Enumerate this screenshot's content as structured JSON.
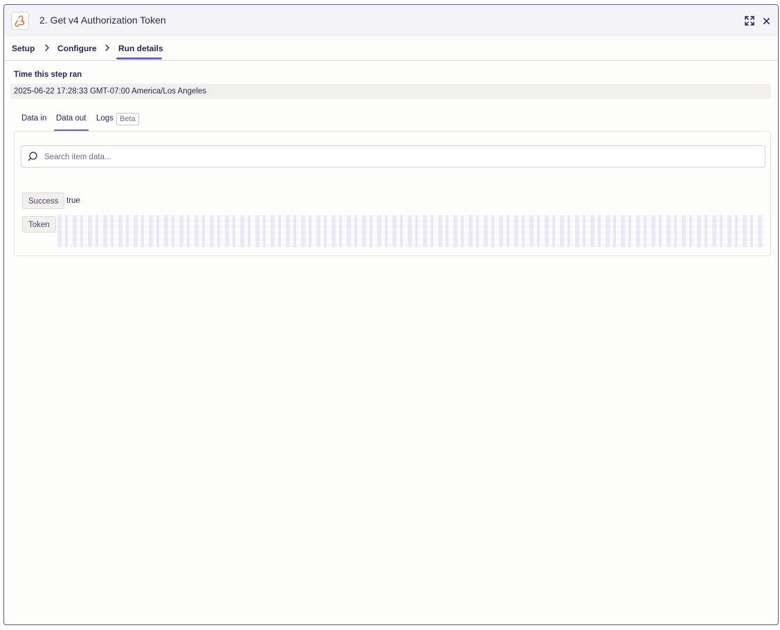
{
  "header": {
    "title": "2. Get v4 Authorization Token",
    "app_icon": "webhook-icon",
    "expand_icon": "expand-icon",
    "close_icon": "close-icon"
  },
  "breadcrumb": {
    "items": [
      {
        "label": "Setup"
      },
      {
        "label": "Configure"
      },
      {
        "label": "Run details",
        "active": true
      }
    ]
  },
  "run": {
    "time_label": "Time this step ran",
    "time_value": "2025-06-22 17:28:33 GMT-07:00 America/Los Angeles"
  },
  "tabs": {
    "items": [
      {
        "label": "Data in"
      },
      {
        "label": "Data out",
        "active": true
      },
      {
        "label": "Logs"
      }
    ],
    "logs_badge": "Beta"
  },
  "search": {
    "placeholder": "Search item data..."
  },
  "fields": [
    {
      "key": "Success",
      "value": "true"
    },
    {
      "key": "Token",
      "value": ""
    }
  ],
  "colors": {
    "accent": "#6a5fc1",
    "border": "#5d52a8",
    "brand_icon": "#e0672b"
  }
}
